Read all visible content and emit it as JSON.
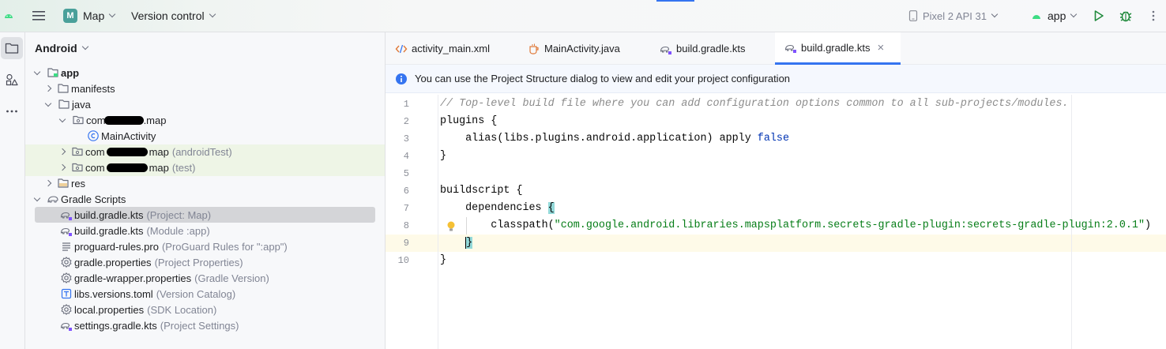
{
  "toolbar": {
    "project_badge": "M",
    "project_name": "Map",
    "vcs_label": "Version control",
    "device": "Pixel 2 API 31",
    "run_config": "app"
  },
  "project_pane": {
    "view_label": "Android",
    "tree": [
      {
        "label": "app",
        "hint": ""
      },
      {
        "label": "manifests",
        "hint": ""
      },
      {
        "label": "java",
        "hint": ""
      },
      {
        "label_prefix": "com",
        "label_suffix": ".map",
        "hint": ""
      },
      {
        "label": "MainActivity",
        "hint": ""
      },
      {
        "label_prefix": "com",
        "label_suffix": "map",
        "hint": "(androidTest)"
      },
      {
        "label_prefix": "com",
        "label_suffix": "map",
        "hint": "(test)"
      },
      {
        "label": "res",
        "hint": ""
      },
      {
        "label": "Gradle Scripts",
        "hint": ""
      },
      {
        "label": "build.gradle.kts",
        "hint": "(Project: Map)"
      },
      {
        "label": "build.gradle.kts",
        "hint": "(Module :app)"
      },
      {
        "label": "proguard-rules.pro",
        "hint": "(ProGuard Rules for \":app\")"
      },
      {
        "label": "gradle.properties",
        "hint": "(Project Properties)"
      },
      {
        "label": "gradle-wrapper.properties",
        "hint": "(Gradle Version)"
      },
      {
        "label": "libs.versions.toml",
        "hint": "(Version Catalog)"
      },
      {
        "label": "local.properties",
        "hint": "(SDK Location)"
      },
      {
        "label": "settings.gradle.kts",
        "hint": "(Project Settings)"
      }
    ]
  },
  "editor": {
    "tabs": [
      {
        "label": "activity_main.xml"
      },
      {
        "label": "MainActivity.java"
      },
      {
        "label": "build.gradle.kts"
      },
      {
        "label": "build.gradle.kts"
      }
    ],
    "close_glyph": "×",
    "banner_text": "You can use the Project Structure dialog to view and edit your project configuration",
    "line_numbers": [
      "1",
      "2",
      "3",
      "4",
      "5",
      "6",
      "7",
      "8",
      "9",
      "10"
    ],
    "code": {
      "l1": "// Top-level build file where you can add configuration options common to all sub-projects/modules.",
      "l2a": "plugins ",
      "l2b": "{",
      "l3a": "    alias(libs.plugins.android.application) apply ",
      "l3b": "false",
      "l4": "}",
      "l6a": "buildscript ",
      "l6b": "{",
      "l7a": "    dependencies ",
      "l7b": "{",
      "l8a": "        classpath(",
      "l8b": "\"com.google.android.libraries.mapsplatform.secrets-gradle-plugin:secrets-gradle-plugin:2.0.1\"",
      "l8c": ")",
      "l9a": "    ",
      "l9b": "}",
      "l10": "}"
    }
  },
  "colors": {
    "accent": "#3574f0",
    "selection": "#d4d5d8",
    "test_row": "#eef5e6",
    "keyword": "#0033b3",
    "string": "#067d17",
    "comment": "#8c8c8c"
  }
}
